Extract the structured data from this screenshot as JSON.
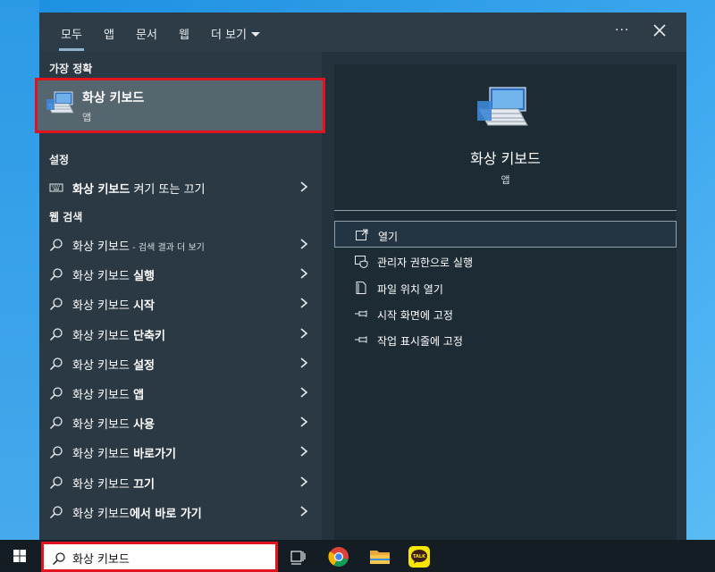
{
  "tabs": [
    {
      "label": "모두",
      "active": true
    },
    {
      "label": "앱"
    },
    {
      "label": "문서"
    },
    {
      "label": "웹"
    },
    {
      "label": "더 보기"
    }
  ],
  "header": {
    "more_label": "···"
  },
  "best_match": {
    "header": "가장 정확",
    "title": "화상 키보드",
    "subtitle": "앱"
  },
  "settings": {
    "header": "설정",
    "items": [
      {
        "bold": "화상 키보드",
        "rest": " 켜기 또는 끄기"
      }
    ]
  },
  "web_search": {
    "header": "웹 검색",
    "items": [
      {
        "bold": "화상 키보드",
        "small": " - 검색 결과 더 보기",
        "rest": ""
      },
      {
        "bold": "화상 키보드 ",
        "rest": "실행"
      },
      {
        "bold": "화상 키보드 ",
        "rest": "시작"
      },
      {
        "bold": "화상 키보드 ",
        "rest": "단축키"
      },
      {
        "bold": "화상 키보드 ",
        "rest": "설정"
      },
      {
        "bold": "화상 키보드 ",
        "rest": "앱"
      },
      {
        "bold": "화상 키보드 ",
        "rest": "사용"
      },
      {
        "bold": "화상 키보드 ",
        "rest": "바로가기"
      },
      {
        "bold": "화상 키보드 ",
        "rest": "끄기"
      },
      {
        "bold": "화상 키보드",
        "rest": "에서 바로 가기"
      }
    ]
  },
  "preview": {
    "app_name": "화상 키보드",
    "app_type": "앱",
    "actions": [
      {
        "label": "열기",
        "icon": "open-icon"
      },
      {
        "label": "관리자 권한으로 실행",
        "icon": "shield-icon"
      },
      {
        "label": "파일 위치 열기",
        "icon": "file-location-icon"
      },
      {
        "label": "시작 화면에 고정",
        "icon": "pin-icon"
      },
      {
        "label": "작업 표시줄에 고정",
        "icon": "pin-icon"
      }
    ]
  },
  "taskbar": {
    "search_value": "화상 키보드",
    "apps": [
      "task-view-icon",
      "chrome-icon",
      "file-explorer-icon",
      "kakaotalk-icon"
    ],
    "kakao_label": "TALK"
  },
  "colors": {
    "highlight_border": "#e0141e",
    "panel_bg": "#24323d",
    "taskbar_bg": "#151d24"
  }
}
